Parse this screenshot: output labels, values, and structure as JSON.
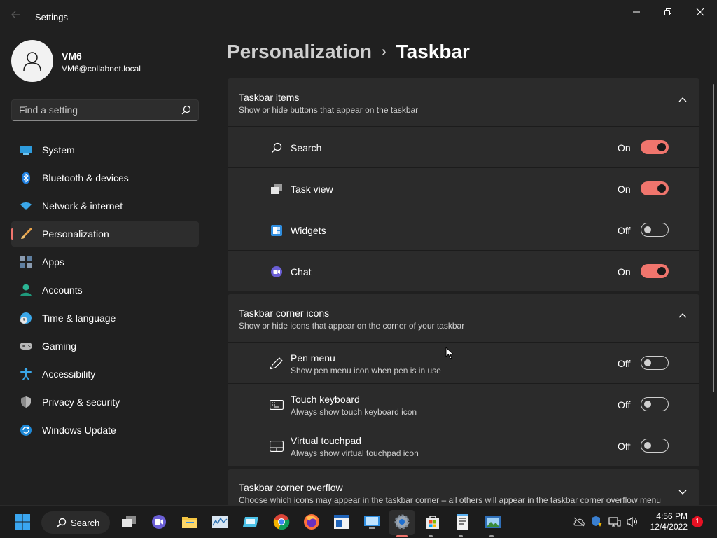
{
  "window": {
    "app_title": "Settings"
  },
  "profile": {
    "name": "VM6",
    "email": "VM6@collabnet.local"
  },
  "search": {
    "placeholder": "Find a setting"
  },
  "sidebar": {
    "items": [
      {
        "label": "System",
        "icon": "system-icon"
      },
      {
        "label": "Bluetooth & devices",
        "icon": "bluetooth-icon"
      },
      {
        "label": "Network & internet",
        "icon": "wifi-icon"
      },
      {
        "label": "Personalization",
        "icon": "paintbrush-icon",
        "selected": true
      },
      {
        "label": "Apps",
        "icon": "apps-icon"
      },
      {
        "label": "Accounts",
        "icon": "person-icon"
      },
      {
        "label": "Time & language",
        "icon": "clock-globe-icon"
      },
      {
        "label": "Gaming",
        "icon": "gamepad-icon"
      },
      {
        "label": "Accessibility",
        "icon": "accessibility-icon"
      },
      {
        "label": "Privacy & security",
        "icon": "shield-icon"
      },
      {
        "label": "Windows Update",
        "icon": "update-icon"
      }
    ]
  },
  "breadcrumb": {
    "parent": "Personalization",
    "separator": "›",
    "current": "Taskbar"
  },
  "groups": {
    "taskbar_items": {
      "title": "Taskbar items",
      "subtitle": "Show or hide buttons that appear on the taskbar",
      "rows": [
        {
          "label": "Search",
          "state": "On",
          "on": true,
          "icon": "search-icon"
        },
        {
          "label": "Task view",
          "state": "On",
          "on": true,
          "icon": "task-view-icon"
        },
        {
          "label": "Widgets",
          "state": "Off",
          "on": false,
          "icon": "widgets-icon"
        },
        {
          "label": "Chat",
          "state": "On",
          "on": true,
          "icon": "chat-icon"
        }
      ]
    },
    "corner_icons": {
      "title": "Taskbar corner icons",
      "subtitle": "Show or hide icons that appear on the corner of your taskbar",
      "rows": [
        {
          "label": "Pen menu",
          "desc": "Show pen menu icon when pen is in use",
          "state": "Off",
          "on": false,
          "icon": "pen-icon"
        },
        {
          "label": "Touch keyboard",
          "desc": "Always show touch keyboard icon",
          "state": "Off",
          "on": false,
          "icon": "keyboard-icon"
        },
        {
          "label": "Virtual touchpad",
          "desc": "Always show virtual touchpad icon",
          "state": "Off",
          "on": false,
          "icon": "touchpad-icon"
        }
      ]
    },
    "corner_overflow": {
      "title": "Taskbar corner overflow",
      "subtitle": "Choose which icons may appear in the taskbar corner – all others will appear in the taskbar corner overflow menu"
    }
  },
  "taskbar": {
    "search_label": "Search",
    "clock_time": "4:56 PM",
    "clock_date": "12/4/2022",
    "notification_count": "1"
  },
  "colors": {
    "accent": "#f0756d",
    "background": "#202020",
    "card": "#2b2b2b"
  }
}
